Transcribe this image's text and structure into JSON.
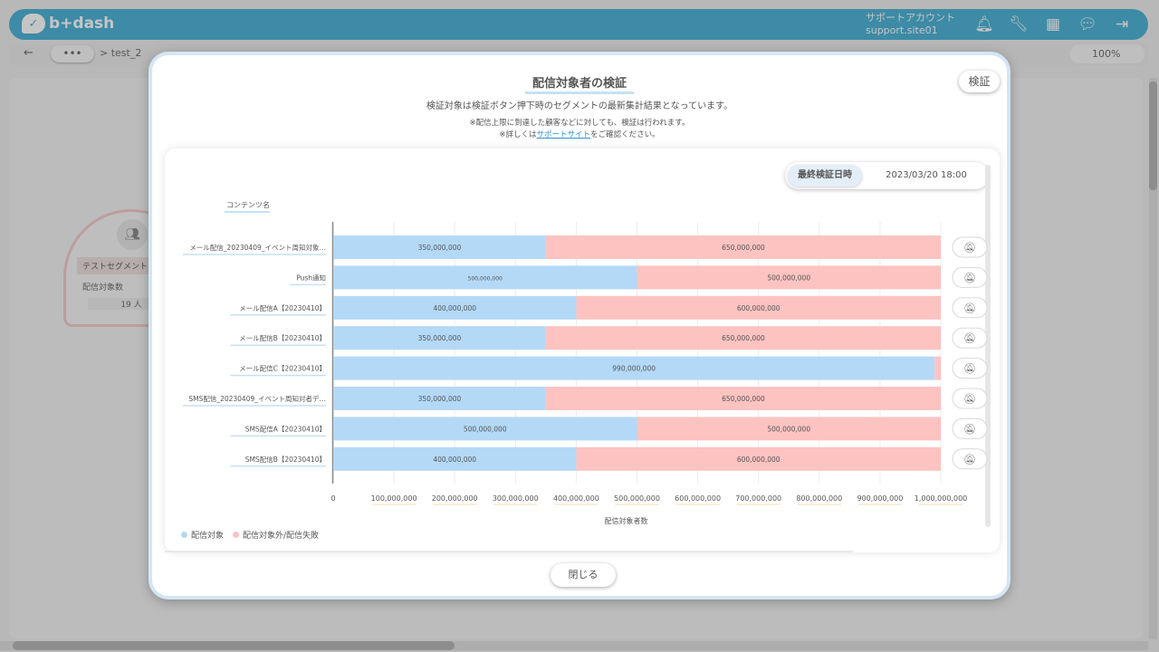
{
  "app": {
    "logo_text": "b+dash",
    "account_name": "サポートアカウント",
    "account_site": "support.site01"
  },
  "subbar": {
    "back_icon": "←",
    "more_label": "•••",
    "breadcrumb": "> test_2",
    "zoom": "100%"
  },
  "canvas_node": {
    "title": "テストセグメント",
    "row_label": "配信対象数",
    "count": "19 人"
  },
  "modal": {
    "title": "配信対象者の検証",
    "verify_button": "検証",
    "description": "検証対象は検証ボタン押下時のセグメントの最新集計結果となっています。",
    "note1": "※配信上限に到達した顧客などに対しても、検証は行われます。",
    "note2_prefix": "※詳しくは",
    "note2_link": "サポートサイト",
    "note2_suffix": "をご確認ください。",
    "last_verify_label": "最終検証日時",
    "last_verify_value": "2023/03/20 18:00",
    "close_button": "閉じる"
  },
  "chart_data": {
    "type": "bar",
    "orientation": "horizontal",
    "stacked": true,
    "category_axis_title": "コンテンツ名",
    "value_axis_title": "配信対象者数",
    "categories": [
      "メール配信_20230409_イベント周知対象…",
      "Push通知",
      "メール配信A【20230410】",
      "メール配信B【20230410】",
      "メール配信C【20230410】",
      "SMS配信_20230409_イベント周知対者デ…",
      "SMS配信A【20230410】",
      "SMS配信B【20230410】"
    ],
    "series": [
      {
        "name": "配信対象",
        "color": "#b3d9f7",
        "values": [
          350000000,
          500000000,
          400000000,
          350000000,
          990000000,
          350000000,
          500000000,
          400000000
        ]
      },
      {
        "name": "配信対象外/配信失敗",
        "color": "#fcc3c1",
        "values": [
          650000000,
          500000000,
          600000000,
          650000000,
          10000000,
          650000000,
          500000000,
          600000000
        ]
      }
    ],
    "value_labels": [
      [
        "350,000,000",
        "650,000,000"
      ],
      [
        "500,000,000",
        "500,000,000"
      ],
      [
        "400,000,000",
        "600,000,000"
      ],
      [
        "350,000,000",
        "650,000,000"
      ],
      [
        "990,000,000",
        ""
      ],
      [
        "350,000,000",
        "650,000,000"
      ],
      [
        "500,000,000",
        "500,000,000"
      ],
      [
        "400,000,000",
        "600,000,000"
      ]
    ],
    "x_ticks": [
      "0",
      "100,000,000",
      "200,000,000",
      "300,000,000",
      "400,000,000",
      "500,000,000",
      "600,000,000",
      "700,000,000",
      "800,000,000",
      "900,000,000",
      "1,000,000,000"
    ],
    "xlim": [
      0,
      1000000000
    ],
    "grid": true,
    "legend_position": "bottom-left",
    "row_action_icon": "notification-off-icon"
  }
}
